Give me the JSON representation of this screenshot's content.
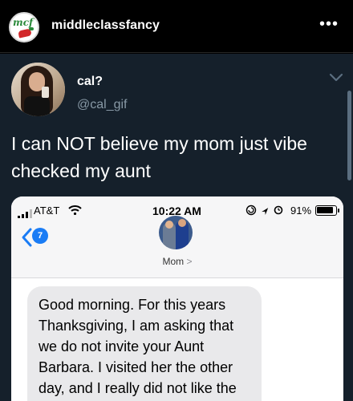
{
  "instagram": {
    "account_name": "middleclassfancy",
    "logo_text": "mcf",
    "more_label": "•••"
  },
  "tweet": {
    "display_name": "cal?",
    "handle": "@cal_gif",
    "text": "I can NOT believe my mom just vibe checked my aunt"
  },
  "imessage": {
    "status_bar": {
      "carrier": "AT&T",
      "time": "10:22 AM",
      "battery_percent": "91%"
    },
    "back_badge_count": "7",
    "contact_name": "Mom",
    "contact_chevron": ">",
    "message": "Good morning. For this years Thanksgiving, I am asking that we do not invite your Aunt Barbara. I visited her the other day, and I really did not like the energy she was projecting. We"
  },
  "colors": {
    "tweet_bg": "#15202b",
    "imessage_blue": "#1a7cf5",
    "bubble_gray": "#e9e9eb"
  }
}
